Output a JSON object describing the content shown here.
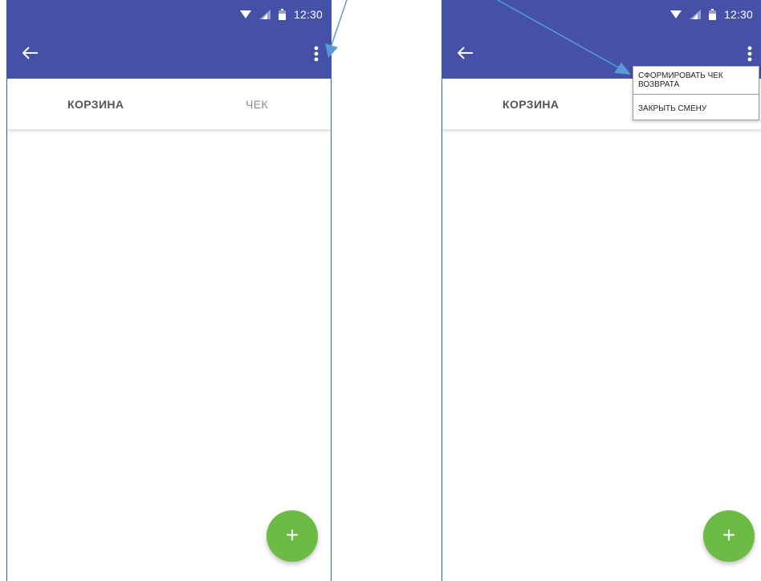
{
  "colors": {
    "appbar": "#4451a6",
    "fab": "#6cbb45",
    "annotation_arrow": "#5a9ad6",
    "phone_border": "#2e63a8"
  },
  "left_screen": {
    "status": {
      "time": "12:30",
      "icons": [
        "wifi-icon",
        "signal-icon",
        "battery-icon"
      ]
    },
    "toolbar": {
      "back_icon": "arrow-left-icon",
      "menu_icon": "more-vert-icon"
    },
    "tabs": [
      {
        "label": "КОРЗИНА",
        "active": true
      },
      {
        "label": "ЧЕК",
        "active": false
      }
    ],
    "fab": {
      "label": "+"
    }
  },
  "right_screen": {
    "status": {
      "time": "12:30",
      "icons": [
        "wifi-icon",
        "signal-icon",
        "battery-icon"
      ]
    },
    "toolbar": {
      "back_icon": "arrow-left-icon",
      "menu_icon": "more-vert-icon"
    },
    "tabs": [
      {
        "label": "КОРЗИНА",
        "active": true
      }
    ],
    "overflow_menu": {
      "items": [
        {
          "label": "СФОРМИРОВАТЬ ЧЕК ВОЗВРАТА"
        },
        {
          "label": "ЗАКРЫТЬ СМЕНУ"
        }
      ]
    },
    "fab": {
      "label": "+"
    }
  }
}
